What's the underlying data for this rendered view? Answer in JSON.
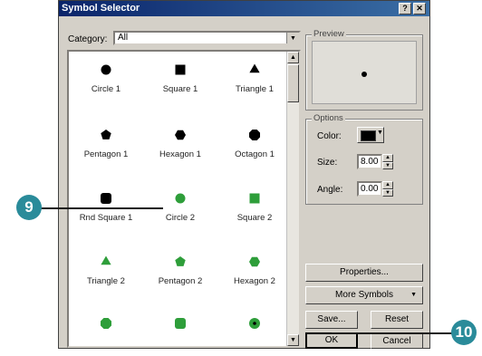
{
  "dialog": {
    "title": "Symbol Selector",
    "help_button": "?",
    "close_button": "✕"
  },
  "category": {
    "label": "Category:",
    "value": "All"
  },
  "symbols": [
    {
      "label": "Circle 1",
      "shape": "circle",
      "color": "#000000"
    },
    {
      "label": "Square 1",
      "shape": "square",
      "color": "#000000"
    },
    {
      "label": "Triangle 1",
      "shape": "triangle",
      "color": "#000000"
    },
    {
      "label": "Pentagon 1",
      "shape": "pentagon",
      "color": "#000000"
    },
    {
      "label": "Hexagon 1",
      "shape": "hexagon",
      "color": "#000000"
    },
    {
      "label": "Octagon 1",
      "shape": "octagon",
      "color": "#000000"
    },
    {
      "label": "Rnd Square 1",
      "shape": "roundsquare",
      "color": "#000000"
    },
    {
      "label": "Circle 2",
      "shape": "circle",
      "color": "#2e9e3a"
    },
    {
      "label": "Square 2",
      "shape": "square",
      "color": "#2e9e3a"
    },
    {
      "label": "Triangle 2",
      "shape": "triangle",
      "color": "#2e9e3a"
    },
    {
      "label": "Pentagon 2",
      "shape": "pentagon",
      "color": "#2e9e3a"
    },
    {
      "label": "Hexagon 2",
      "shape": "hexagon",
      "color": "#2e9e3a"
    },
    {
      "label": "",
      "shape": "octagon",
      "color": "#2e9e3a"
    },
    {
      "label": "",
      "shape": "roundsquare",
      "color": "#2e9e3a"
    },
    {
      "label": "",
      "shape": "ringdot",
      "color": "#2e9e3a"
    }
  ],
  "preview": {
    "label": "Preview"
  },
  "options": {
    "label": "Options",
    "color_label": "Color:",
    "size_label": "Size:",
    "size_value": "8.00",
    "angle_label": "Angle:",
    "angle_value": "0.00",
    "color_swatch": "#000000"
  },
  "buttons": {
    "properties": "Properties...",
    "more_symbols": "More Symbols",
    "save": "Save...",
    "reset": "Reset",
    "ok": "OK",
    "cancel": "Cancel"
  },
  "callouts": {
    "step_a": "9",
    "step_b": "10"
  },
  "colors": {
    "accent_teal": "#2a8b9a",
    "symbol_green": "#2e9e3a",
    "title_blue": "#0a246a"
  }
}
